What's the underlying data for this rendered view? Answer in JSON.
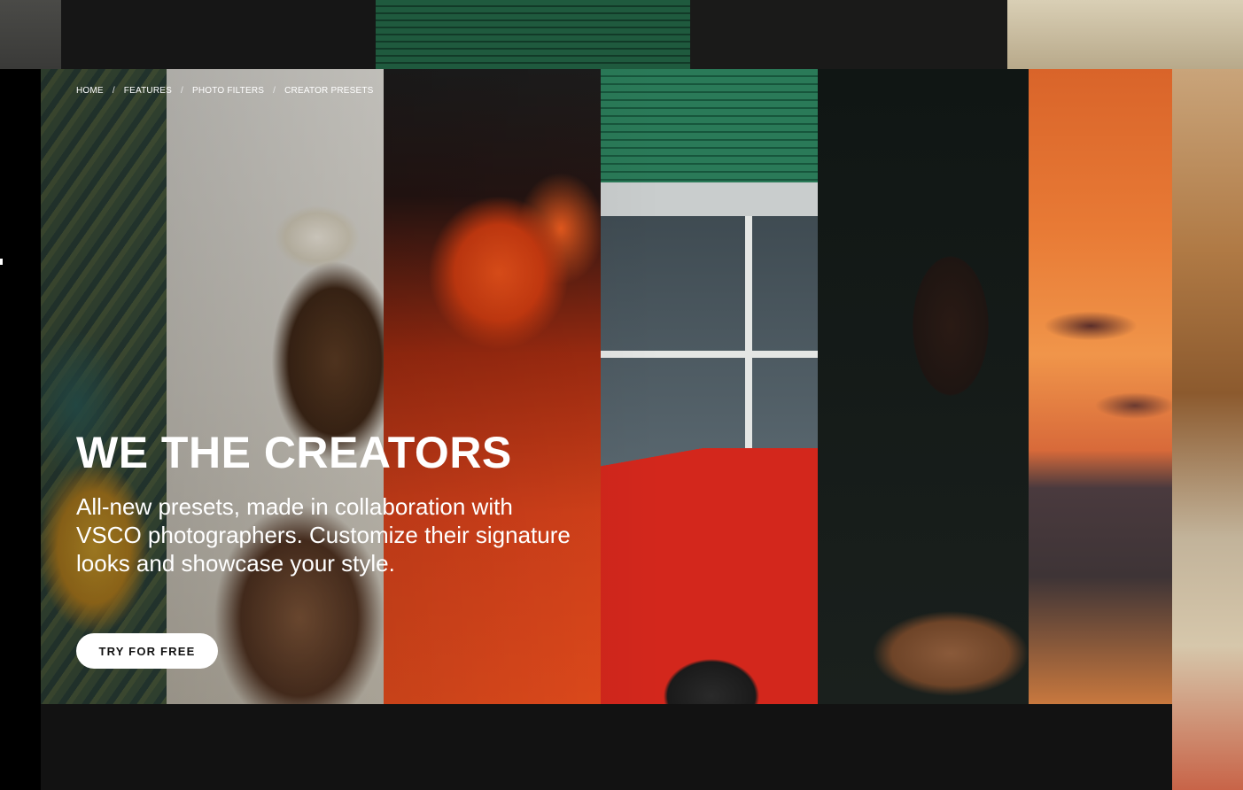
{
  "breadcrumb": {
    "items": [
      {
        "label": "HOME"
      },
      {
        "label": "FEATURES"
      },
      {
        "label": "PHOTO FILTERS"
      },
      {
        "label": "CREATOR PRESETS"
      }
    ],
    "separator": "/"
  },
  "hero": {
    "title": "WE THE CREATORS",
    "subtitle": "All-new presets, made in collaboration with VSCO photographers. Customize their signature looks and showcase your style.",
    "cta_label": "TRY FOR FREE"
  },
  "colors": {
    "cta_bg": "#ffffff",
    "cta_text": "#111111",
    "page_bg": "#000000",
    "footer_bg": "#121212"
  }
}
